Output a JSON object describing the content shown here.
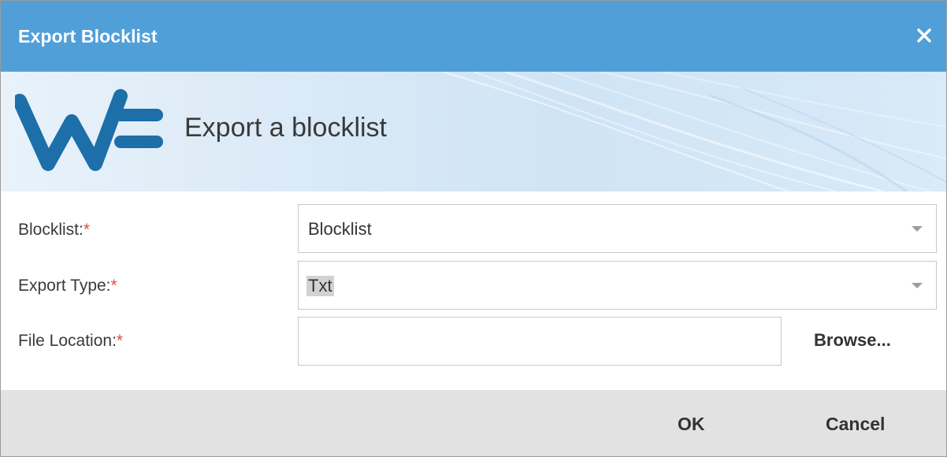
{
  "dialog": {
    "title": "Export Blocklist",
    "close_icon": "close-icon"
  },
  "banner": {
    "logo_icon": "wf-logo-icon",
    "heading": "Export a blocklist"
  },
  "form": {
    "blocklist": {
      "label": "Blocklist:",
      "required_mark": "*",
      "value": "Blocklist"
    },
    "export_type": {
      "label": "Export Type:",
      "required_mark": "*",
      "value": "Txt"
    },
    "file_location": {
      "label": "File Location:",
      "required_mark": "*",
      "value": "",
      "browse_label": "Browse..."
    }
  },
  "footer": {
    "ok_label": "OK",
    "cancel_label": "Cancel"
  },
  "colors": {
    "titlebar": "#519fd9",
    "logo": "#1c6fa8",
    "required": "#e04a4a",
    "footer": "#e2e2e2"
  }
}
